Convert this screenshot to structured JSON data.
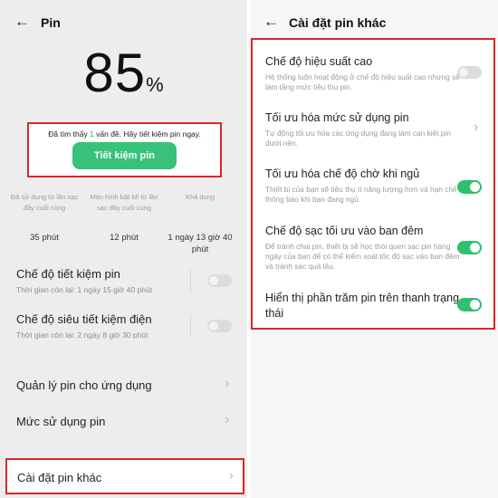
{
  "left": {
    "title": "Pin",
    "battery_number": "85",
    "battery_unit": "%",
    "alert": {
      "prefix": "Đã tìm thấy ",
      "count": "1",
      "suffix": " vấn đề. Hãy tiết kiệm pin ngay.",
      "button": "Tiết kiệm pin"
    },
    "stats": [
      {
        "label": "Đã sử dụng từ lần sạc đầy cuối cùng",
        "value": "35 phút"
      },
      {
        "label": "Màn hình bật kể từ lần sạc đầy cuối cùng",
        "value": "12 phút"
      },
      {
        "label": "Khả dụng",
        "value": "1 ngày 13 giờ 40 phút"
      }
    ],
    "modes": [
      {
        "title": "Chế độ tiết kiệm pin",
        "sub": "Thời gian còn lại: 1 ngày 15 giờ 40 phút"
      },
      {
        "title": "Chế độ siêu tiết kiệm điện",
        "sub": "Thời gian còn lại: 2 ngày 8 giờ 30 phút"
      }
    ],
    "links": [
      "Quản lý pin cho ứng dụng",
      "Mức sử dụng pin",
      "Cài đặt pin khác"
    ]
  },
  "right": {
    "title": "Cài đặt pin khác",
    "items": [
      {
        "title": "Chế độ hiệu suất cao",
        "sub": "Hệ thống luôn hoạt động ở chế độ hiệu suất cao nhưng sẽ làm tăng mức tiêu thụ pin.",
        "control": "toggle",
        "state": "off"
      },
      {
        "title": "Tối ưu hóa mức sử dụng pin",
        "sub": "Tự động tối ưu hóa các ứng dụng đang làm cạn kiệt pin dưới nền.",
        "control": "chevron"
      },
      {
        "title": "Tối ưu hóa chế độ chờ khi ngủ",
        "sub": "Thiết bị của bạn sẽ tiêu thụ ít năng lượng hơn và hạn chế thông báo khi bạn đang ngủ.",
        "control": "toggle",
        "state": "on"
      },
      {
        "title": "Chế độ sạc tối ưu vào ban đêm",
        "sub": "Để tránh chai pin, thiết bị sẽ học thói quen sạc pin hàng ngày của bạn để có thể kiểm soát tốc độ sạc vào ban đêm và tránh sạc quá lâu.",
        "control": "toggle",
        "state": "on"
      },
      {
        "title": "Hiển thị phần trăm pin trên thanh trạng thái",
        "sub": "",
        "control": "toggle",
        "state": "on"
      }
    ]
  },
  "colors": {
    "accent_green": "#37c27b",
    "highlight_red": "#e02424"
  }
}
